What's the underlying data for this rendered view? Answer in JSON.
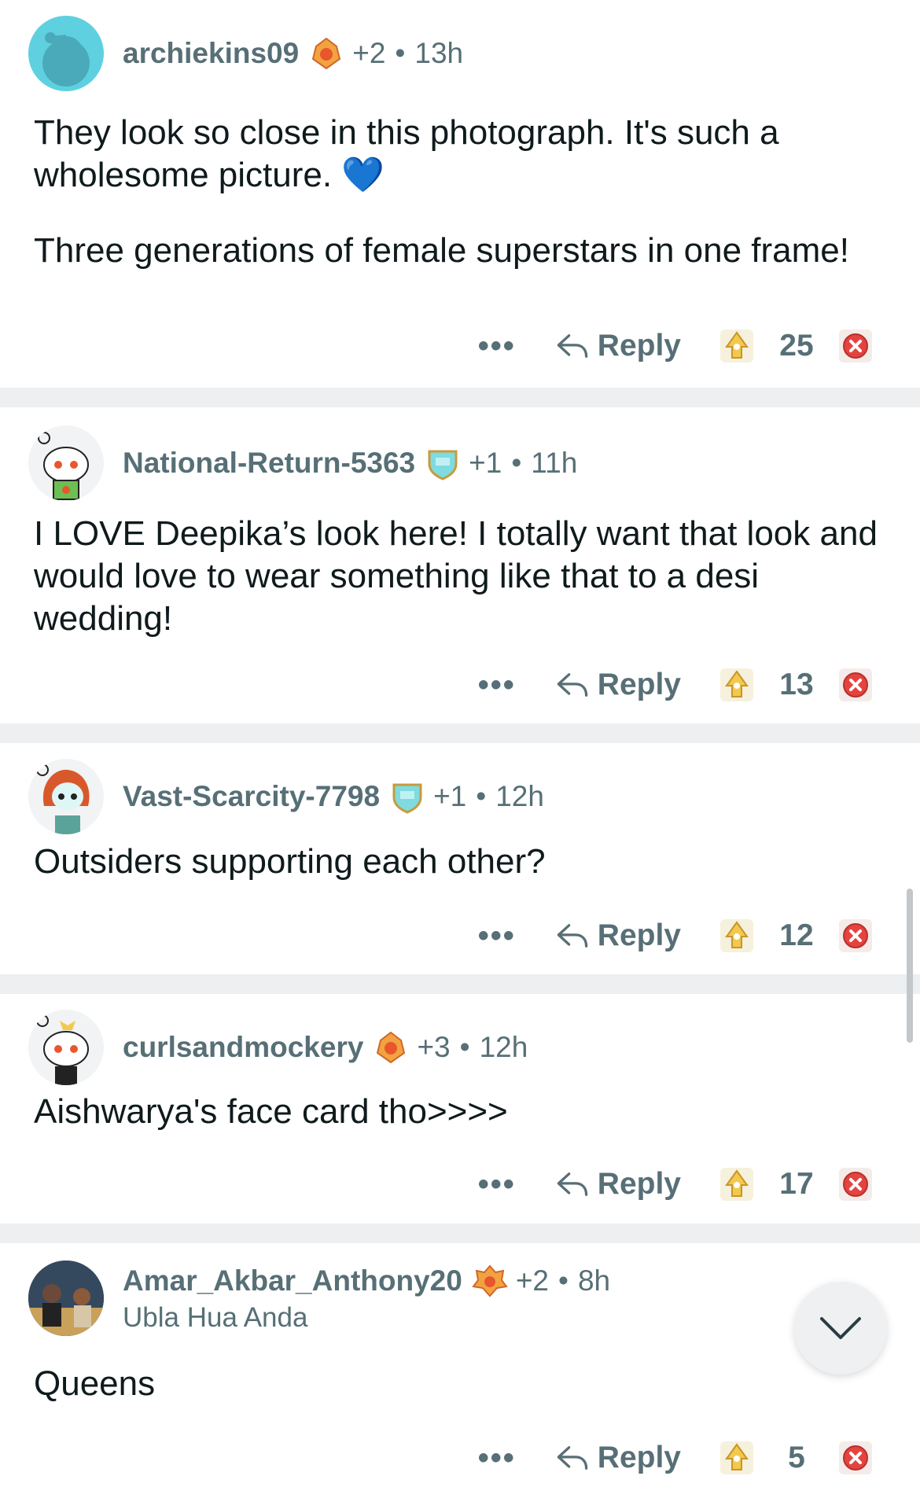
{
  "comments": [
    {
      "username": "archiekins09",
      "awards_extra": "+2",
      "time": "13h",
      "body": [
        "They look so close in this photograph. It's such a wholesome picture. 💙",
        "Three generations of female superstars in one frame!"
      ],
      "reply_label": "Reply",
      "more_label": "•••",
      "score": "25"
    },
    {
      "username": "National-Return-5363",
      "awards_extra": "+1",
      "time": "11h",
      "body": [
        "I LOVE Deepika’s look here! I totally want that look and would love to wear something like that to a desi wedding!"
      ],
      "reply_label": "Reply",
      "more_label": "•••",
      "score": "13"
    },
    {
      "username": "Vast-Scarcity-7798",
      "awards_extra": "+1",
      "time": "12h",
      "body": [
        "Outsiders supporting each other?"
      ],
      "reply_label": "Reply",
      "more_label": "•••",
      "score": "12"
    },
    {
      "username": "curlsandmockery",
      "awards_extra": "+3",
      "time": "12h",
      "body": [
        "Aishwarya's face card tho>>>>"
      ],
      "reply_label": "Reply",
      "more_label": "•••",
      "score": "17"
    },
    {
      "username": "Amar_Akbar_Anthony20",
      "flair": "Ubla Hua Anda",
      "awards_extra": "+2",
      "time": "8h",
      "body": [
        "Queens"
      ],
      "reply_label": "Reply",
      "more_label": "•••",
      "score": "5"
    }
  ],
  "dot_separator": "•",
  "icons": {
    "reply": "reply-arrow-icon",
    "upvote": "upvote-award-icon",
    "downvote": "downvote-x-icon",
    "fab": "chevron-down-icon"
  },
  "colors": {
    "meta_text": "#576f76",
    "separator": "#edeff1",
    "downvote": "#e4433f",
    "upvote": "#f2c94c"
  }
}
